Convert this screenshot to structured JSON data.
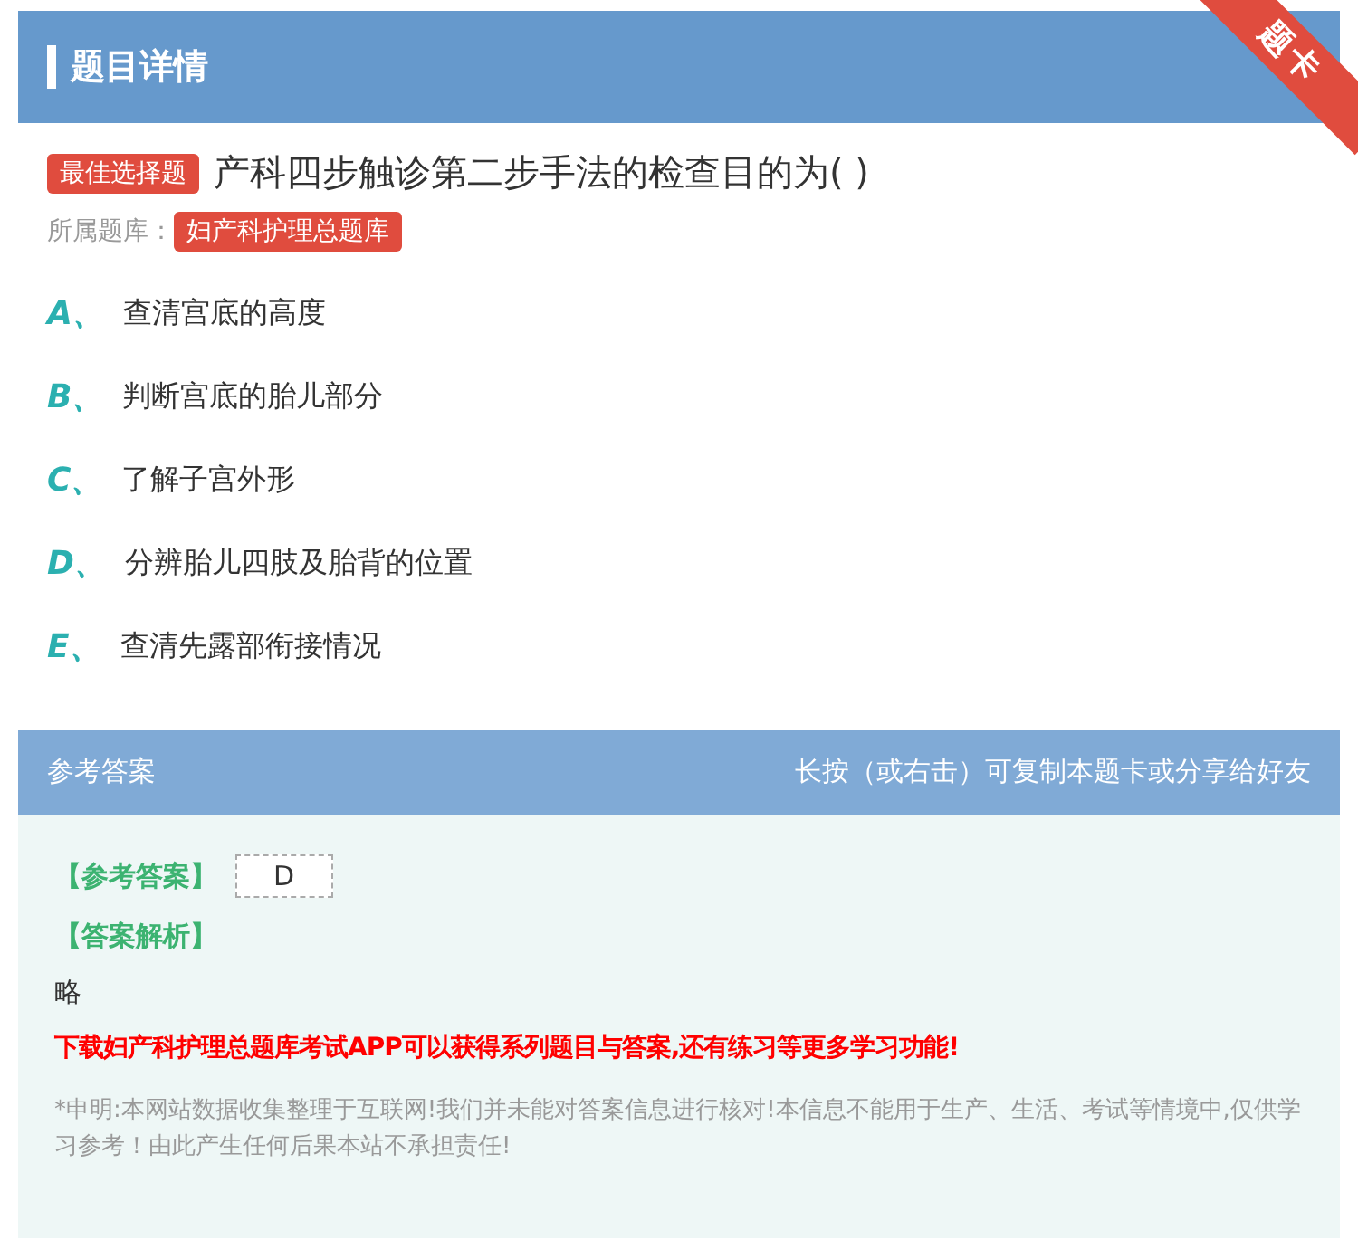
{
  "header": {
    "title": "题目详情",
    "ribbon": "题卡"
  },
  "question": {
    "type_tag": "最佳选择题",
    "text": "产科四步触诊第二步手法的检查目的为( )",
    "bank_label": "所属题库：",
    "bank": "妇产科护理总题库"
  },
  "options": [
    {
      "letter": "A",
      "sep": "、",
      "text": "查清宫底的高度"
    },
    {
      "letter": "B",
      "sep": "、",
      "text": "判断宫底的胎儿部分"
    },
    {
      "letter": "C",
      "sep": "、",
      "text": "了解子宫外形"
    },
    {
      "letter": "D",
      "sep": "、",
      "text": "分辨胎儿四肢及胎背的位置"
    },
    {
      "letter": "E",
      "sep": "、",
      "text": "查清先露部衔接情况"
    }
  ],
  "answer_section": {
    "title": "参考答案",
    "hint": "长按（或右击）可复制本题卡或分享给好友",
    "answer_label": "【参考答案】",
    "answer": "D",
    "analysis_label": "【答案解析】",
    "analysis": "略",
    "promo": "下载妇产科护理总题库考试APP可以获得系列题目与答案,还有练习等更多学习功能!",
    "disclaimer": "*申明:本网站数据收集整理于互联网!我们并未能对答案信息进行核对!本信息不能用于生产、生活、考试等情境中,仅供学习参考！由此产生任何后果本站不承担责任!"
  }
}
